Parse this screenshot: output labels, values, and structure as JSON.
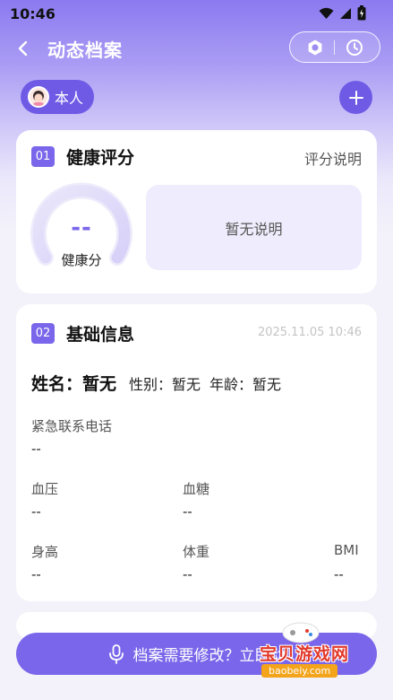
{
  "status_bar": {
    "time": "10:46"
  },
  "header": {
    "title": "动态档案"
  },
  "profile": {
    "chip_label": "本人"
  },
  "section1": {
    "num": "01",
    "title": "健康评分",
    "right_link": "评分说明",
    "score": "--",
    "score_label": "健康分",
    "description": "暂无说明"
  },
  "section2": {
    "num": "02",
    "title": "基础信息",
    "date": "2025.11.05 10:46",
    "name_text": "姓名：暂无",
    "gender_text": "性别：暂无",
    "age_text": "年龄：暂无",
    "emergency_label": "紧急联系电话",
    "emergency_value": "--",
    "bp_label": "血压",
    "bp_value": "--",
    "sugar_label": "血糖",
    "sugar_value": "--",
    "height_label": "身高",
    "height_value": "--",
    "weight_label": "体重",
    "weight_value": "--",
    "bmi_label": "BMI",
    "bmi_value": "--"
  },
  "bottom_bar": {
    "label": "档案需要修改？立即动"
  },
  "watermark": {
    "text": "宝贝游戏网",
    "url": "baobeiy.com"
  },
  "colors": {
    "accent": "#7a66ea",
    "chip": "#6f5ae6",
    "desc_bg": "#efedfd"
  },
  "icons": {
    "back": "chevron-left-icon",
    "camera": "camera-icon",
    "clock": "clock-icon",
    "add": "plus-icon",
    "mic": "microphone-icon"
  }
}
